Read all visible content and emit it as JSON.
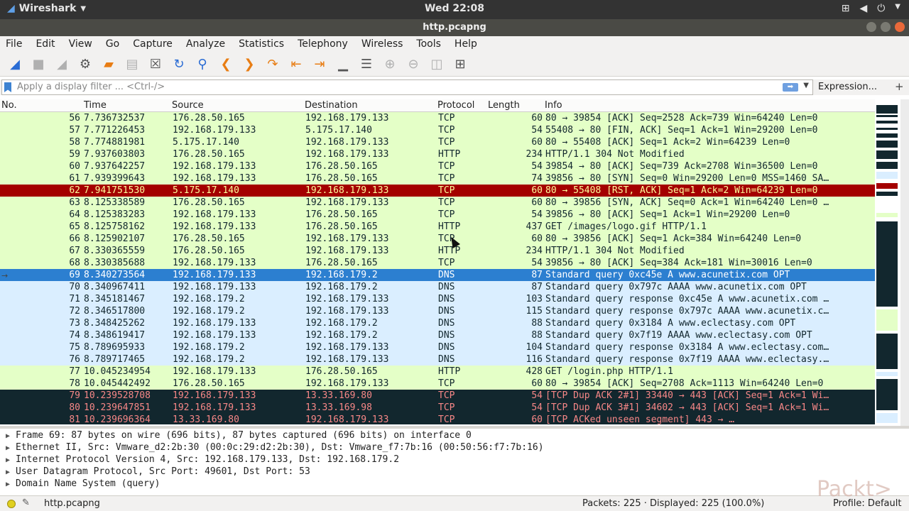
{
  "topbar": {
    "app": "Wireshark",
    "clock": "Wed 22:08"
  },
  "window": {
    "title": "http.pcapng"
  },
  "menu": [
    "File",
    "Edit",
    "View",
    "Go",
    "Capture",
    "Analyze",
    "Statistics",
    "Telephony",
    "Wireless",
    "Tools",
    "Help"
  ],
  "filter": {
    "placeholder": "Apply a display filter ... <Ctrl-/>",
    "expression": "Expression...",
    "plus": "+"
  },
  "columns": {
    "no": "No.",
    "time": "Time",
    "source": "Source",
    "destination": "Destination",
    "protocol": "Protocol",
    "length": "Length",
    "info": "Info"
  },
  "packets": [
    {
      "no": "56",
      "time": "7.736732537",
      "src": "176.28.50.165",
      "dst": "192.168.179.133",
      "proto": "TCP",
      "len": "60",
      "info": "80 → 39854 [ACK] Seq=2528 Ack=739 Win=64240 Len=0",
      "bg": "#e4ffc7",
      "fg": "#12272e"
    },
    {
      "no": "57",
      "time": "7.771226453",
      "src": "192.168.179.133",
      "dst": "5.175.17.140",
      "proto": "TCP",
      "len": "54",
      "info": "55408 → 80 [FIN, ACK] Seq=1 Ack=1 Win=29200 Len=0",
      "bg": "#e4ffc7",
      "fg": "#12272e"
    },
    {
      "no": "58",
      "time": "7.774881981",
      "src": "5.175.17.140",
      "dst": "192.168.179.133",
      "proto": "TCP",
      "len": "60",
      "info": "80 → 55408 [ACK] Seq=1 Ack=2 Win=64239 Len=0",
      "bg": "#e4ffc7",
      "fg": "#12272e"
    },
    {
      "no": "59",
      "time": "7.937603803",
      "src": "176.28.50.165",
      "dst": "192.168.179.133",
      "proto": "HTTP",
      "len": "234",
      "info": "HTTP/1.1 304 Not Modified",
      "bg": "#e4ffc7",
      "fg": "#12272e"
    },
    {
      "no": "60",
      "time": "7.937642257",
      "src": "192.168.179.133",
      "dst": "176.28.50.165",
      "proto": "TCP",
      "len": "54",
      "info": "39854 → 80 [ACK] Seq=739 Ack=2708 Win=36500 Len=0",
      "bg": "#e4ffc7",
      "fg": "#12272e"
    },
    {
      "no": "61",
      "time": "7.939399643",
      "src": "192.168.179.133",
      "dst": "176.28.50.165",
      "proto": "TCP",
      "len": "74",
      "info": "39856 → 80 [SYN] Seq=0 Win=29200 Len=0 MSS=1460 SA…",
      "bg": "#e4ffc7",
      "fg": "#12272e"
    },
    {
      "no": "62",
      "time": "7.941751530",
      "src": "5.175.17.140",
      "dst": "192.168.179.133",
      "proto": "TCP",
      "len": "60",
      "info": "80 → 55408 [RST, ACK] Seq=1 Ack=2 Win=64239 Len=0",
      "bg": "#a40000",
      "fg": "#fffc9c"
    },
    {
      "no": "63",
      "time": "8.125338589",
      "src": "176.28.50.165",
      "dst": "192.168.179.133",
      "proto": "TCP",
      "len": "60",
      "info": "80 → 39856 [SYN, ACK] Seq=0 Ack=1 Win=64240 Len=0 …",
      "bg": "#e4ffc7",
      "fg": "#12272e"
    },
    {
      "no": "64",
      "time": "8.125383283",
      "src": "192.168.179.133",
      "dst": "176.28.50.165",
      "proto": "TCP",
      "len": "54",
      "info": "39856 → 80 [ACK] Seq=1 Ack=1 Win=29200 Len=0",
      "bg": "#e4ffc7",
      "fg": "#12272e"
    },
    {
      "no": "65",
      "time": "8.125758162",
      "src": "192.168.179.133",
      "dst": "176.28.50.165",
      "proto": "HTTP",
      "len": "437",
      "info": "GET /images/logo.gif HTTP/1.1",
      "bg": "#e4ffc7",
      "fg": "#12272e"
    },
    {
      "no": "66",
      "time": "8.125902107",
      "src": "176.28.50.165",
      "dst": "192.168.179.133",
      "proto": "TCP",
      "len": "60",
      "info": "80 → 39856 [ACK] Seq=1 Ack=384 Win=64240 Len=0",
      "bg": "#e4ffc7",
      "fg": "#12272e"
    },
    {
      "no": "67",
      "time": "8.330365559",
      "src": "176.28.50.165",
      "dst": "192.168.179.133",
      "proto": "HTTP",
      "len": "234",
      "info": "HTTP/1.1 304 Not Modified",
      "bg": "#e4ffc7",
      "fg": "#12272e"
    },
    {
      "no": "68",
      "time": "8.330385688",
      "src": "192.168.179.133",
      "dst": "176.28.50.165",
      "proto": "TCP",
      "len": "54",
      "info": "39856 → 80 [ACK] Seq=384 Ack=181 Win=30016 Len=0",
      "bg": "#e4ffc7",
      "fg": "#12272e"
    },
    {
      "no": "69",
      "time": "8.340273564",
      "src": "192.168.179.133",
      "dst": "192.168.179.2",
      "proto": "DNS",
      "len": "87",
      "info": "Standard query 0xc45e A www.acunetix.com OPT",
      "bg": "#2c7fd0",
      "fg": "#ffffff"
    },
    {
      "no": "70",
      "time": "8.340967411",
      "src": "192.168.179.133",
      "dst": "192.168.179.2",
      "proto": "DNS",
      "len": "87",
      "info": "Standard query 0x797c AAAA www.acunetix.com OPT",
      "bg": "#daeeff",
      "fg": "#12272e"
    },
    {
      "no": "71",
      "time": "8.345181467",
      "src": "192.168.179.2",
      "dst": "192.168.179.133",
      "proto": "DNS",
      "len": "103",
      "info": "Standard query response 0xc45e A www.acunetix.com …",
      "bg": "#daeeff",
      "fg": "#12272e"
    },
    {
      "no": "72",
      "time": "8.346517800",
      "src": "192.168.179.2",
      "dst": "192.168.179.133",
      "proto": "DNS",
      "len": "115",
      "info": "Standard query response 0x797c AAAA www.acunetix.c…",
      "bg": "#daeeff",
      "fg": "#12272e"
    },
    {
      "no": "73",
      "time": "8.348425262",
      "src": "192.168.179.133",
      "dst": "192.168.179.2",
      "proto": "DNS",
      "len": "88",
      "info": "Standard query 0x3184 A www.eclectasy.com OPT",
      "bg": "#daeeff",
      "fg": "#12272e"
    },
    {
      "no": "74",
      "time": "8.348619417",
      "src": "192.168.179.133",
      "dst": "192.168.179.2",
      "proto": "DNS",
      "len": "88",
      "info": "Standard query 0x7f19 AAAA www.eclectasy.com OPT",
      "bg": "#daeeff",
      "fg": "#12272e"
    },
    {
      "no": "75",
      "time": "8.789695933",
      "src": "192.168.179.2",
      "dst": "192.168.179.133",
      "proto": "DNS",
      "len": "104",
      "info": "Standard query response 0x3184 A www.eclectasy.com…",
      "bg": "#daeeff",
      "fg": "#12272e"
    },
    {
      "no": "76",
      "time": "8.789717465",
      "src": "192.168.179.2",
      "dst": "192.168.179.133",
      "proto": "DNS",
      "len": "116",
      "info": "Standard query response 0x7f19 AAAA www.eclectasy.…",
      "bg": "#daeeff",
      "fg": "#12272e"
    },
    {
      "no": "77",
      "time": "10.045234954",
      "src": "192.168.179.133",
      "dst": "176.28.50.165",
      "proto": "HTTP",
      "len": "428",
      "info": "GET /login.php HTTP/1.1",
      "bg": "#e4ffc7",
      "fg": "#12272e"
    },
    {
      "no": "78",
      "time": "10.045442492",
      "src": "176.28.50.165",
      "dst": "192.168.179.133",
      "proto": "TCP",
      "len": "60",
      "info": "80 → 39854 [ACK] Seq=2708 Ack=1113 Win=64240 Len=0",
      "bg": "#e4ffc7",
      "fg": "#12272e"
    },
    {
      "no": "79",
      "time": "10.239528708",
      "src": "192.168.179.133",
      "dst": "13.33.169.80",
      "proto": "TCP",
      "len": "54",
      "info": "[TCP Dup ACK 2#1] 33440 → 443 [ACK] Seq=1 Ack=1 Wi…",
      "bg": "#12272e",
      "fg": "#f78787"
    },
    {
      "no": "80",
      "time": "10.239647851",
      "src": "192.168.179.133",
      "dst": "13.33.169.98",
      "proto": "TCP",
      "len": "54",
      "info": "[TCP Dup ACK 3#1] 34602 → 443 [ACK] Seq=1 Ack=1 Wi…",
      "bg": "#12272e",
      "fg": "#f78787"
    },
    {
      "no": "81",
      "time": "10.239696364",
      "src": "13.33.169.80",
      "dst": "192.168.179.133",
      "proto": "TCP",
      "len": "60",
      "info": "[TCP ACKed unseen segment] 443 → …",
      "bg": "#12272e",
      "fg": "#f78787"
    }
  ],
  "details": [
    "Frame 69: 87 bytes on wire (696 bits), 87 bytes captured (696 bits) on interface 0",
    "Ethernet II, Src: Vmware_d2:2b:30 (00:0c:29:d2:2b:30), Dst: Vmware_f7:7b:16 (00:50:56:f7:7b:16)",
    "Internet Protocol Version 4, Src: 192.168.179.133, Dst: 192.168.179.2",
    "User Datagram Protocol, Src Port: 49601, Dst Port: 53",
    "Domain Name System (query)"
  ],
  "status": {
    "file": "http.pcapng",
    "packets": "Packets: 225 · Displayed: 225 (100.0%)",
    "profile": "Profile: Default"
  },
  "watermark": "Packt>"
}
